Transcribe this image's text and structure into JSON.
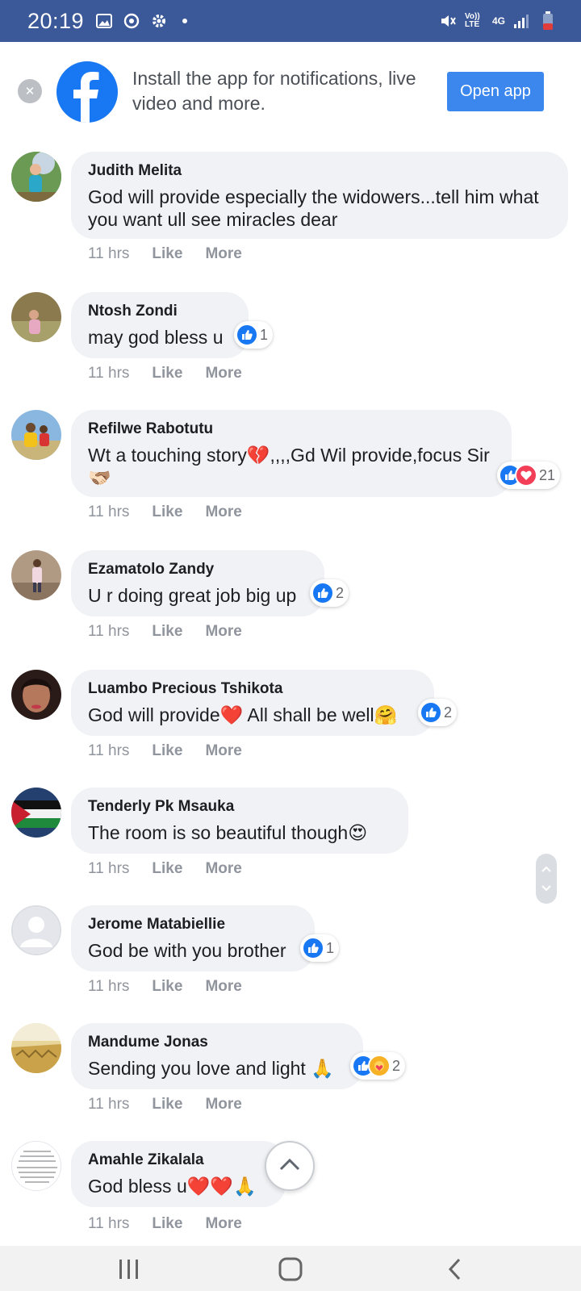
{
  "status_bar": {
    "time": "20:19",
    "network_label": "4G",
    "volte_label": "Vo)) LTE",
    "left_icons": [
      "gallery-icon",
      "sync-icon",
      "settings-icon"
    ],
    "right_icons": [
      "mute-icon",
      "volte-icon",
      "signal-icon",
      "battery-icon"
    ]
  },
  "banner": {
    "message": "Install the app for notifications, live video and more.",
    "button_label": "Open app",
    "close_label": "✕"
  },
  "comments": [
    {
      "author": "Judith Melita",
      "text": "God will provide especially the widowers...tell him what you want ull see miracles dear",
      "time": "11 hrs",
      "like": "Like",
      "more": "More",
      "reaction_count": ""
    },
    {
      "author": "Ntosh Zondi",
      "text": "may god bless u",
      "time": "11 hrs",
      "like": "Like",
      "more": "More",
      "reaction_count": "1"
    },
    {
      "author": "Refilwe Rabotutu",
      "text": "Wt a touching story💔,,,,Gd Wil provide,focus Sir🫱🏻‍🫲🏽",
      "time": "11 hrs",
      "like": "Like",
      "more": "More",
      "reaction_count": "21"
    },
    {
      "author": "Ezamatolo Zandy",
      "text": "U r doing great job big up",
      "time": "11 hrs",
      "like": "Like",
      "more": "More",
      "reaction_count": "2"
    },
    {
      "author": "Luambo Precious Tshikota",
      "text": "God will provide❤️ All shall be well🤗",
      "time": "11 hrs",
      "like": "Like",
      "more": "More",
      "reaction_count": "2"
    },
    {
      "author": "Tenderly Pk Msauka",
      "text": "The room is so beautiful though😍",
      "time": "11 hrs",
      "like": "Like",
      "more": "More",
      "reaction_count": ""
    },
    {
      "author": "Jerome Matabiellie",
      "text": "God be with you brother",
      "time": "11 hrs",
      "like": "Like",
      "more": "More",
      "reaction_count": "1"
    },
    {
      "author": "Mandume Jonas",
      "text": "Sending you love and light 🙏",
      "time": "11 hrs",
      "like": "Like",
      "more": "More",
      "reaction_count": "2"
    },
    {
      "author": "Amahle Zikalala",
      "text": "God bless u❤️❤️🙏",
      "time": "11 hrs",
      "like": "Like",
      "more": "More",
      "reaction_count": ""
    }
  ],
  "colors": {
    "status_bar": "#3b5998",
    "facebook_blue": "#1877f2",
    "bubble": "#f0f2f5",
    "meta_text": "#90949c",
    "love_red": "#f33e58"
  }
}
